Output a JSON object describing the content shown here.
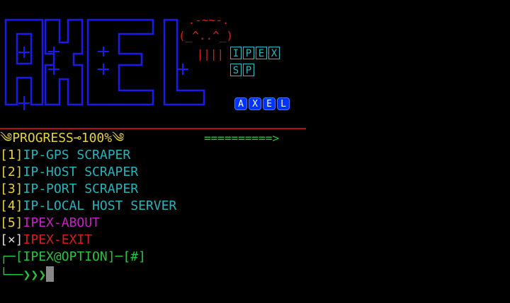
{
  "logo": {
    "letters": [
      "A",
      "X",
      "E",
      "L"
    ],
    "color": "#1a1aee",
    "cat_lines": [
      " .-~~-.",
      "(_^..^_)",
      " ||||"
    ],
    "ipex_boxes": [
      "I",
      "P",
      "E",
      "X"
    ],
    "sp_boxes": [
      "S",
      "P"
    ],
    "axel_badges": [
      "A",
      "X",
      "E",
      "L"
    ]
  },
  "progress": {
    "prefix_icon": "ornament-icon",
    "label": "PROGRESS",
    "arrow": "⊸",
    "percent": "100%",
    "bar": "==========>"
  },
  "menu": [
    {
      "num": "[1]",
      "label": "IP-GPS SCRAPER",
      "color": "#26b3bd"
    },
    {
      "num": "[2]",
      "label": "IP-HOST SCRAPER",
      "color": "#26b3bd"
    },
    {
      "num": "[3]",
      "label": "IP-PORT SCRAPER",
      "color": "#26b3bd"
    },
    {
      "num": "[4]",
      "label": "IP-LOCAL HOST SERVER",
      "color": "#26b3bd"
    },
    {
      "num": "[5]",
      "label": "IPEX-ABOUT",
      "color": "#c81fc8"
    },
    {
      "num": "[×]",
      "label": "IPEX-EXIT",
      "color": "#d31f1f"
    }
  ],
  "prompt": {
    "line1_prefix": "┌─",
    "line1_text": "[IPEX@OPTION]─[#]",
    "line2_prefix": "└──",
    "line2_arrows": "❯❯❯"
  }
}
